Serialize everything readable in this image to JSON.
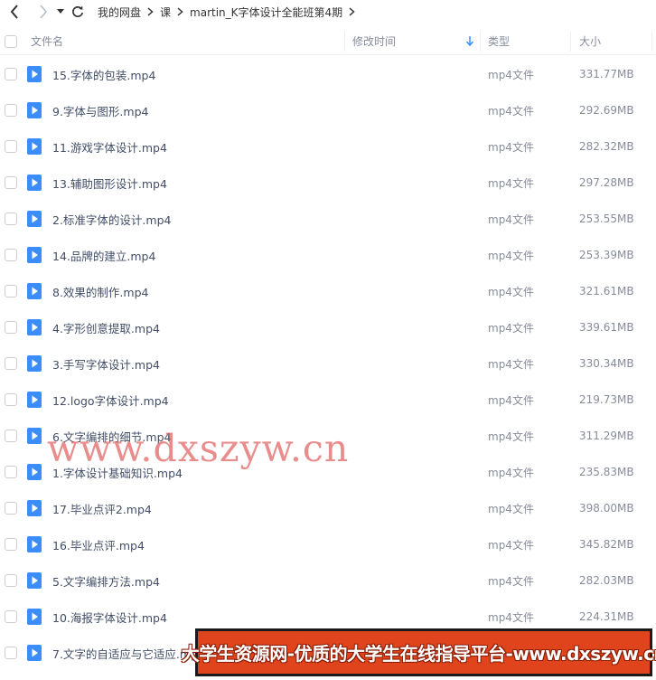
{
  "breadcrumb": [
    "我的网盘",
    "课",
    "martin_K字体设计全能班第4期"
  ],
  "columns": {
    "name": "文件名",
    "modified": "修改时间",
    "type": "类型",
    "size": "大小"
  },
  "files": [
    {
      "name": "15.字体的包装.mp4",
      "type": "mp4文件",
      "size": "331.77MB"
    },
    {
      "name": "9.字体与图形.mp4",
      "type": "mp4文件",
      "size": "292.69MB"
    },
    {
      "name": "11.游戏字体设计.mp4",
      "type": "mp4文件",
      "size": "282.32MB"
    },
    {
      "name": "13.辅助图形设计.mp4",
      "type": "mp4文件",
      "size": "297.28MB"
    },
    {
      "name": "2.标准字体的设计.mp4",
      "type": "mp4文件",
      "size": "253.55MB"
    },
    {
      "name": "14.品牌的建立.mp4",
      "type": "mp4文件",
      "size": "253.39MB"
    },
    {
      "name": "8.效果的制作.mp4",
      "type": "mp4文件",
      "size": "321.61MB"
    },
    {
      "name": "4.字形创意提取.mp4",
      "type": "mp4文件",
      "size": "339.61MB"
    },
    {
      "name": "3.手写字体设计.mp4",
      "type": "mp4文件",
      "size": "330.34MB"
    },
    {
      "name": "12.logo字体设计.mp4",
      "type": "mp4文件",
      "size": "219.73MB"
    },
    {
      "name": "6.文字编排的细节.mp4",
      "type": "mp4文件",
      "size": "311.29MB"
    },
    {
      "name": "1.字体设计基础知识.mp4",
      "type": "mp4文件",
      "size": "235.83MB"
    },
    {
      "name": "17.毕业点评2.mp4",
      "type": "mp4文件",
      "size": "398.00MB"
    },
    {
      "name": "16.毕业点评.mp4",
      "type": "mp4文件",
      "size": "345.82MB"
    },
    {
      "name": "5.文字编排方法.mp4",
      "type": "mp4文件",
      "size": "282.03MB"
    },
    {
      "name": "10.海报字体设计.mp4",
      "type": "mp4文件",
      "size": "224.31MB"
    },
    {
      "name": "7.文字的自适应与它适应.mp4",
      "type": "",
      "size": ""
    }
  ],
  "watermark": "www.dxszyw.cn",
  "banner": "大学生资源网-优质的大学生在线指导平台-www.dxszyw.cn",
  "colors": {
    "accent": "#3b8cff",
    "banner": "#e0441c",
    "watermark": "#e06060"
  },
  "icons": [
    "back-icon",
    "forward-icon",
    "dropdown-icon",
    "refresh-icon",
    "chevron-right-icon",
    "sort-down-icon",
    "video-file-icon"
  ]
}
